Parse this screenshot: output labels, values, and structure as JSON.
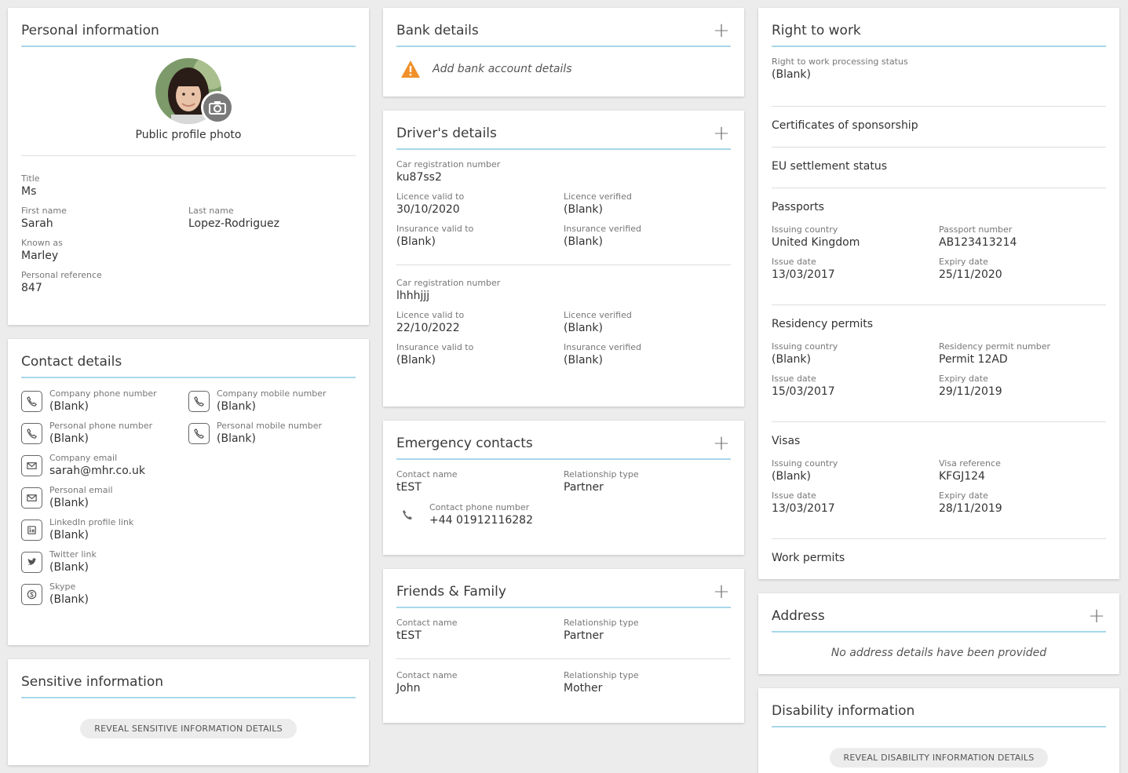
{
  "personal": {
    "title": "Personal information",
    "photo_label": "Public profile photo",
    "title_label": "Title",
    "title_value": "Ms",
    "first_label": "First name",
    "first_value": "Sarah",
    "last_label": "Last name",
    "last_value": "Lopez-Rodriguez",
    "known_label": "Known as",
    "known_value": "Marley",
    "ref_label": "Personal reference",
    "ref_value": "847"
  },
  "contact": {
    "title": "Contact details",
    "company_phone_label": "Company phone number",
    "company_phone": "(Blank)",
    "company_mobile_label": "Company mobile number",
    "company_mobile": "(Blank)",
    "personal_phone_label": "Personal phone number",
    "personal_phone": "(Blank)",
    "personal_mobile_label": "Personal mobile number",
    "personal_mobile": "(Blank)",
    "company_email_label": "Company email",
    "company_email": "sarah@mhr.co.uk",
    "personal_email_label": "Personal email",
    "personal_email": "(Blank)",
    "linkedin_label": "LinkedIn profile link",
    "linkedin": "(Blank)",
    "twitter_label": "Twitter link",
    "twitter": "(Blank)",
    "skype_label": "Skype",
    "skype": "(Blank)"
  },
  "sensitive": {
    "title": "Sensitive information",
    "button": "REVEAL SENSITIVE INFORMATION DETAILS"
  },
  "bank": {
    "title": "Bank details",
    "message": "Add bank account details"
  },
  "drivers": {
    "title": "Driver's details",
    "entries": [
      {
        "car_label": "Car registration number",
        "car": "ku87ss2",
        "lic_valid_label": "Licence valid to",
        "lic_valid": "30/10/2020",
        "lic_ver_label": "Licence verified",
        "lic_ver": "(Blank)",
        "ins_valid_label": "Insurance valid to",
        "ins_valid": "(Blank)",
        "ins_ver_label": "Insurance verified",
        "ins_ver": "(Blank)"
      },
      {
        "car_label": "Car registration number",
        "car": "lhhhjjj",
        "lic_valid_label": "Licence valid to",
        "lic_valid": "22/10/2022",
        "lic_ver_label": "Licence verified",
        "lic_ver": "(Blank)",
        "ins_valid_label": "Insurance valid to",
        "ins_valid": "(Blank)",
        "ins_ver_label": "Insurance verified",
        "ins_ver": "(Blank)"
      }
    ]
  },
  "emergency": {
    "title": "Emergency contacts",
    "name_label": "Contact name",
    "name": "tEST",
    "rel_label": "Relationship type",
    "rel": "Partner",
    "phone_label": "Contact phone number",
    "phone": "+44 01912116282"
  },
  "friends": {
    "title": "Friends & Family",
    "entries": [
      {
        "name_label": "Contact name",
        "name": "tEST",
        "rel_label": "Relationship type",
        "rel": "Partner"
      },
      {
        "name_label": "Contact name",
        "name": "John",
        "rel_label": "Relationship type",
        "rel": "Mother"
      }
    ]
  },
  "rtw": {
    "title": "Right to work",
    "status_label": "Right to work processing status",
    "status": "(Blank)",
    "cos": "Certificates of sponsorship",
    "eu": "EU settlement status",
    "passports": {
      "title": "Passports",
      "country_label": "Issuing country",
      "country": "United Kingdom",
      "number_label": "Passport number",
      "number": "AB123413214",
      "issue_label": "Issue date",
      "issue": "13/03/2017",
      "expiry_label": "Expiry date",
      "expiry": "25/11/2020"
    },
    "residency": {
      "title": "Residency permits",
      "country_label": "Issuing country",
      "country": "(Blank)",
      "number_label": "Residency permit number",
      "number": "Permit 12AD",
      "issue_label": "Issue date",
      "issue": "15/03/2017",
      "expiry_label": "Expiry date",
      "expiry": "29/11/2019"
    },
    "visas": {
      "title": "Visas",
      "country_label": "Issuing country",
      "country": "(Blank)",
      "number_label": "Visa reference",
      "number": "KFGJ124",
      "issue_label": "Issue date",
      "issue": "13/03/2017",
      "expiry_label": "Expiry date",
      "expiry": "28/11/2019"
    },
    "work_permits": "Work permits"
  },
  "address": {
    "title": "Address",
    "message": "No address details have been provided"
  },
  "disability": {
    "title": "Disability information",
    "button": "REVEAL DISABILITY INFORMATION DETAILS"
  },
  "colors": {
    "accent_line": "#a8d8ea",
    "warning": "#f0902a"
  }
}
